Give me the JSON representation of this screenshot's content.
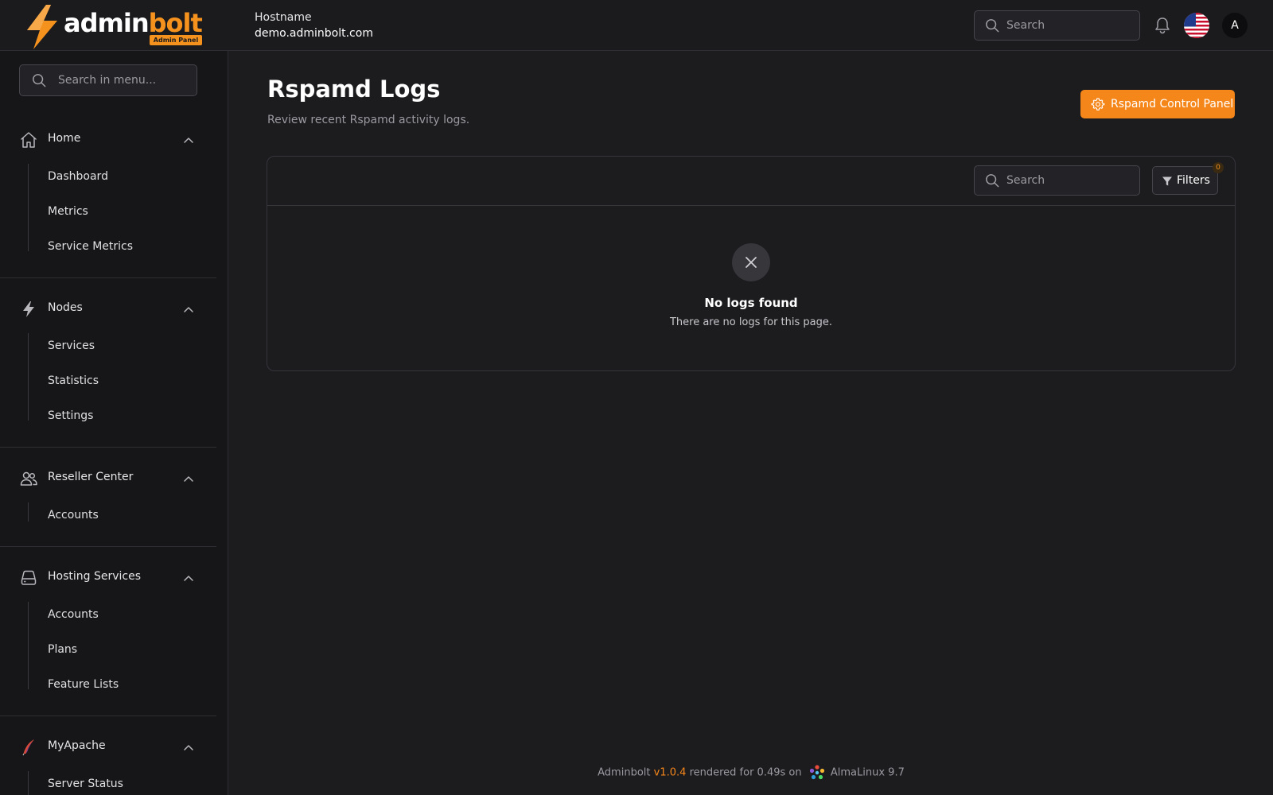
{
  "header": {
    "logo_text_1": "admin",
    "logo_text_2": "bolt",
    "logo_badge": "Admin Panel",
    "hostname_label": "Hostname",
    "hostname_value": "demo.adminbolt.com",
    "search_placeholder": "Search",
    "avatar_initial": "A"
  },
  "sidebar": {
    "search_placeholder": "Search in menu...",
    "sections": [
      {
        "title": "Home",
        "icon": "home-icon",
        "items": [
          "Dashboard",
          "Metrics",
          "Service Metrics"
        ]
      },
      {
        "title": "Nodes",
        "icon": "bolt-icon",
        "items": [
          "Services",
          "Statistics",
          "Settings"
        ]
      },
      {
        "title": "Reseller Center",
        "icon": "users-icon",
        "items": [
          "Accounts"
        ]
      },
      {
        "title": "Hosting Services",
        "icon": "server-icon",
        "items": [
          "Accounts",
          "Plans",
          "Feature Lists"
        ]
      },
      {
        "title": "MyApache",
        "icon": "apache-feather-icon",
        "items": [
          "Server Status"
        ]
      }
    ]
  },
  "main": {
    "title": "Rspamd Logs",
    "subtitle": "Review recent Rspamd activity logs.",
    "control_panel_button": "Rspamd Control Panel",
    "table": {
      "search_placeholder": "Search",
      "filters_label": "Filters",
      "filters_count": "0",
      "empty_title": "No logs found",
      "empty_description": "There are no logs for this page."
    }
  },
  "footer": {
    "app_name": "Adminbolt",
    "version": "v1.0.4",
    "render_text": "rendered for 0.49s on",
    "os": "AlmaLinux 9.7"
  },
  "colors": {
    "accent": "#f5861a",
    "background": "#1c1c1f",
    "sidebar": "#161618"
  }
}
